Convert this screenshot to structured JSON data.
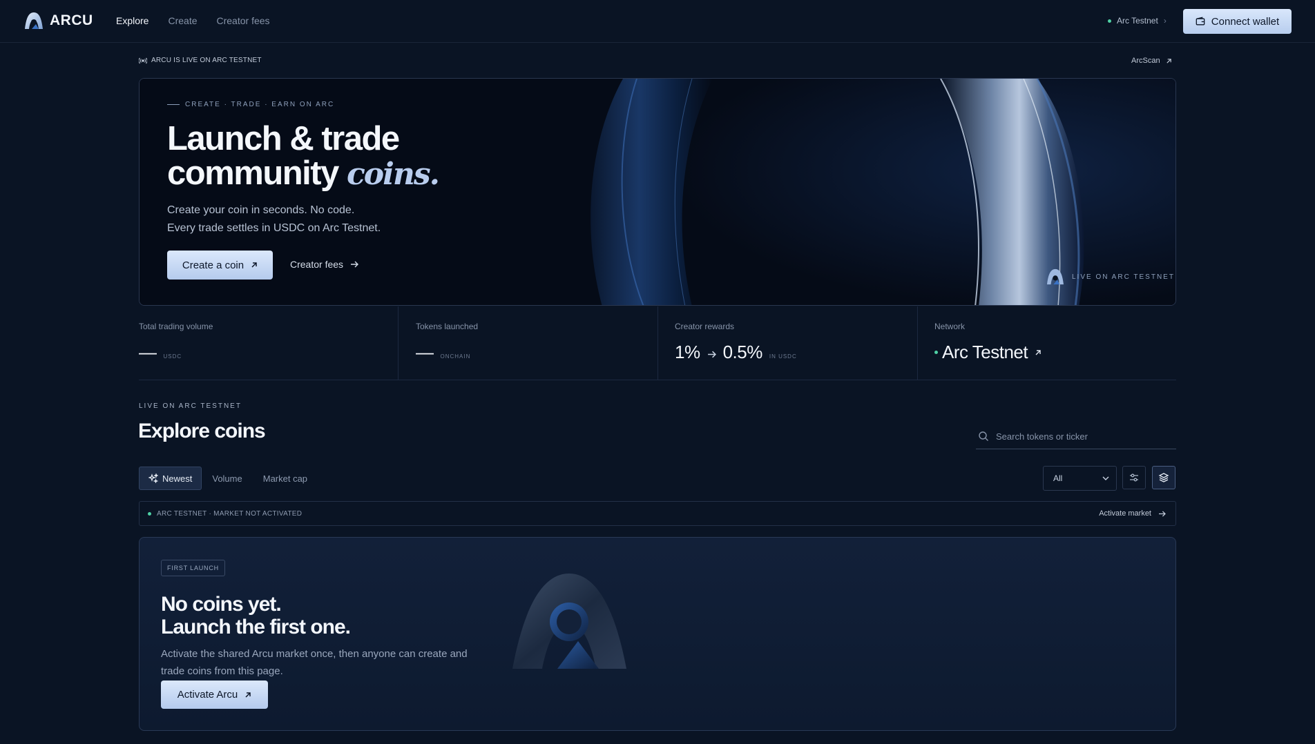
{
  "brand": {
    "name": "ARCU"
  },
  "nav": {
    "links": [
      {
        "label": "Explore",
        "active": true
      },
      {
        "label": "Create",
        "active": false
      },
      {
        "label": "Creator fees",
        "active": false
      }
    ],
    "network": "Arc Testnet",
    "connect_label": "Connect wallet"
  },
  "announcement": {
    "text": "ARCU IS LIVE ON ARC TESTNET",
    "explorer_link": "ArcScan"
  },
  "hero": {
    "eyebrow": "CREATE · TRADE · EARN ON ARC",
    "title_line1": "Launch & trade",
    "title_line2": "community",
    "title_italic": "coins.",
    "subtitle_line1": "Create your coin in seconds. No code.",
    "subtitle_line2": "Every trade settles in USDC on Arc Testnet.",
    "primary_cta": "Create a coin",
    "secondary_cta": "Creator fees",
    "badge": "LIVE ON ARC TESTNET"
  },
  "stats": [
    {
      "label": "Total trading volume",
      "value": "—",
      "unit": "USDC"
    },
    {
      "label": "Tokens launched",
      "value": "—",
      "unit": "ONCHAIN"
    },
    {
      "label": "Creator rewards",
      "value_from": "1%",
      "value_to": "0.5%",
      "unit": "IN USDC"
    },
    {
      "label": "Network",
      "value": "Arc Testnet"
    }
  ],
  "explore": {
    "eyebrow": "LIVE ON ARC TESTNET",
    "title": "Explore coins",
    "search_placeholder": "Search tokens or ticker",
    "tabs": [
      {
        "label": "Newest",
        "active": true
      },
      {
        "label": "Volume",
        "active": false
      },
      {
        "label": "Market cap",
        "active": false
      }
    ],
    "filter_value": "All",
    "status_text": "ARC TESTNET · MARKET NOT ACTIVATED",
    "status_action": "Activate market"
  },
  "empty_state": {
    "badge": "FIRST LAUNCH",
    "title_line1": "No coins yet.",
    "title_line2": "Launch the first one.",
    "subtitle": "Activate the shared Arcu market once, then anyone can create and trade coins from this page.",
    "cta": "Activate Arcu"
  },
  "colors": {
    "background": "#0a1424",
    "accent": "#b7cdee",
    "status_dot": "#4fd1a5"
  }
}
